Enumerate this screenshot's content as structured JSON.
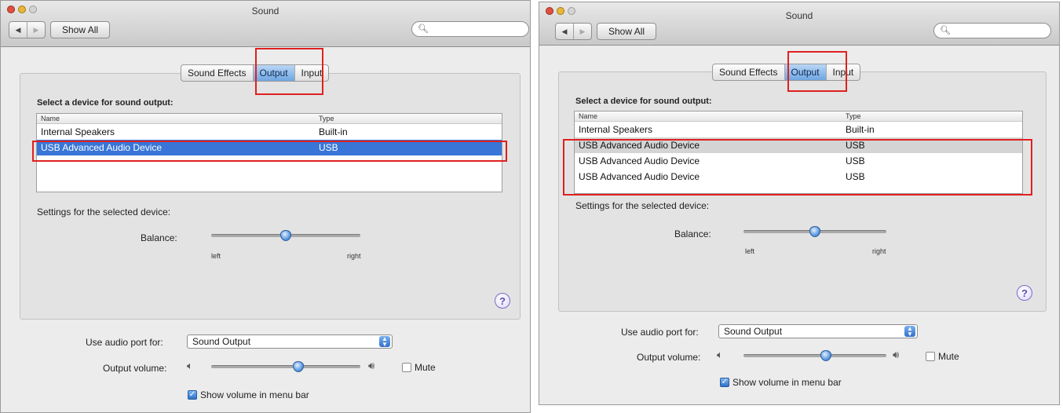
{
  "left": {
    "title": "Sound",
    "show_all": "Show All",
    "search_placeholder": "",
    "tabs": [
      "Sound Effects",
      "Output",
      "Input"
    ],
    "heading": "Select a device for sound output:",
    "columns": [
      "Name",
      "Type"
    ],
    "rows": [
      {
        "name": "Internal Speakers",
        "type": "Built-in"
      },
      {
        "name": "USB Advanced Audio Device",
        "type": "USB"
      }
    ],
    "settings_label": "Settings for the selected device:",
    "balance_label": "Balance:",
    "balance_left": "left",
    "balance_right": "right",
    "balance_value": 0.5,
    "help": "?",
    "port_label": "Use audio port for:",
    "port_value": "Sound Output",
    "volume_label": "Output volume:",
    "volume_value": 0.6,
    "mute_label": "Mute",
    "menu_bar_label": "Show volume in menu bar"
  },
  "right": {
    "title": "Sound",
    "show_all": "Show All",
    "search_placeholder": "",
    "tabs": [
      "Sound Effects",
      "Output",
      "Input"
    ],
    "heading": "Select a device for sound output:",
    "columns": [
      "Name",
      "Type"
    ],
    "rows": [
      {
        "name": "Internal Speakers",
        "type": "Built-in"
      },
      {
        "name": "USB Advanced Audio Device",
        "type": "USB"
      },
      {
        "name": "USB Advanced Audio Device",
        "type": "USB"
      },
      {
        "name": "USB Advanced Audio Device",
        "type": "USB"
      }
    ],
    "settings_label": "Settings for the selected device:",
    "balance_label": "Balance:",
    "balance_left": "left",
    "balance_right": "right",
    "balance_value": 0.5,
    "help": "?",
    "port_label": "Use audio port for:",
    "port_value": "Sound Output",
    "volume_label": "Output volume:",
    "volume_value": 0.58,
    "mute_label": "Mute",
    "menu_bar_label": "Show volume in menu bar"
  },
  "colors": {
    "selection_blue": "#3875d7",
    "highlight_red": "#e02020",
    "active_tab": "#6fa6e2"
  }
}
